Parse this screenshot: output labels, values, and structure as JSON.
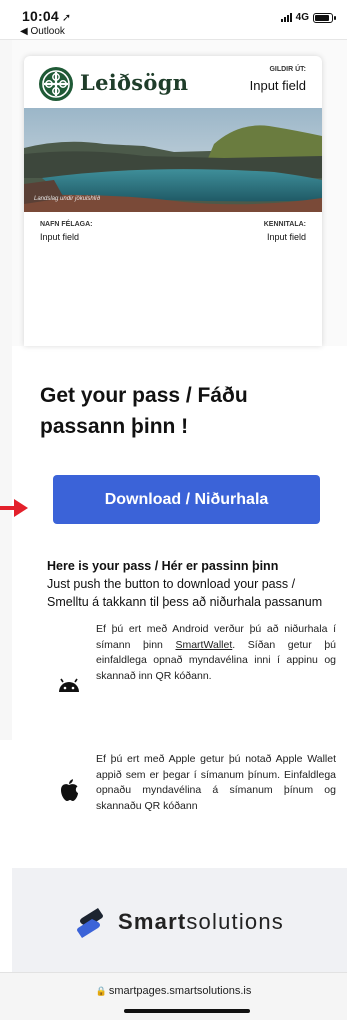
{
  "status_bar": {
    "time": "10:04",
    "back_app": "◀ Outlook",
    "network": "4G",
    "battery_level": 0.85
  },
  "pass_card": {
    "brand": "Leiðsögn",
    "expiry_label": "GILDIR ÚT:",
    "expiry_value": "Input field",
    "photo_caption": "Landslag undir jökulshlíð",
    "name_label": "NAFN FÉLAGA:",
    "name_value": "Input field",
    "id_label": "KENNITALA:",
    "id_value": "Input field"
  },
  "main": {
    "headline": "Get your pass / Fáðu passann þinn !",
    "download_label": "Download / Niðurhala",
    "info_title": "Here is your pass / Hér er passinn þinn",
    "info_body": "Just push the button to download your pass / Smelltu á takkann til þess að niðurhala passanum"
  },
  "platforms": {
    "android_before": "Ef þú ert með Android verður þú að niðurhala í símann þinn ",
    "android_link": "SmartWallet",
    "android_after": ". Síðan getur þú einfaldlega opnað myndavélina inni í appinu og skannað inn QR kóðann.",
    "apple_text": "Ef þú ert með Apple getur þú notað Apple Wallet appið sem er þegar í símanum þínum. Einfaldlega opnaðu myndavélina á símanum þínum og skannaðu QR kóðann"
  },
  "footer": {
    "brand_bold": "Smart",
    "brand_rest": "solutions",
    "url": "smartpages.smartsolutions.is"
  },
  "colors": {
    "button": "#3b63d8",
    "arrow": "#e3202b",
    "brand_green": "#1f3d2a"
  }
}
